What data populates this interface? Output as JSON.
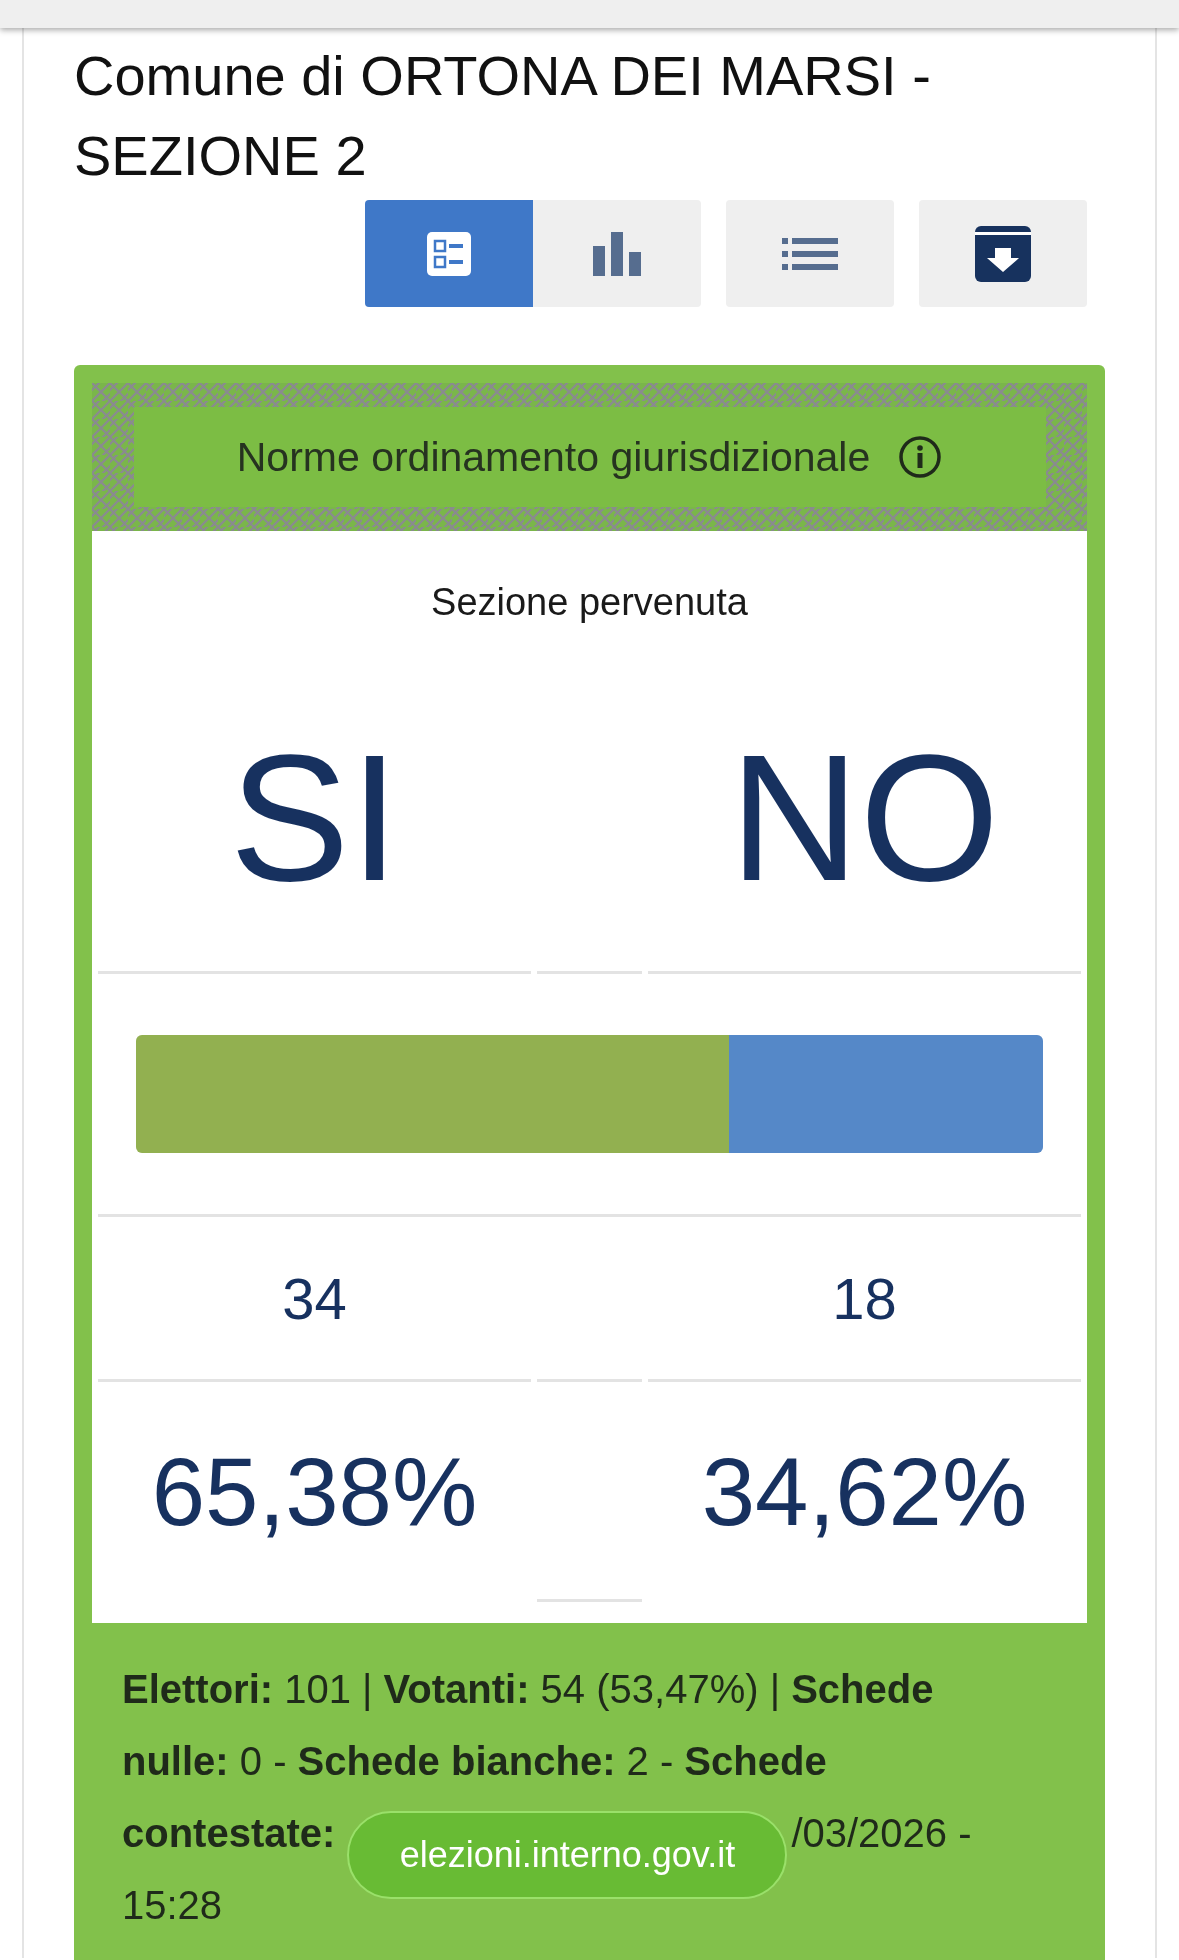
{
  "title": "Comune di ORTONA DEI MARSI - SEZIONE 2",
  "view_buttons": [
    {
      "kind": "summary",
      "selected": true
    },
    {
      "kind": "chart",
      "selected": false
    },
    {
      "kind": "list",
      "selected": false
    },
    {
      "kind": "archive",
      "selected": false
    }
  ],
  "card": {
    "heading": "Norme ordinamento giurisdizionale",
    "status": "Sezione pervenuta",
    "results": [
      {
        "label": "SI",
        "votes": "34",
        "percent": "65,38%",
        "level": 0.6538,
        "color": "#92b050"
      },
      {
        "label": "NO",
        "votes": "18",
        "percent": "34,62%",
        "level": 0.3462,
        "color": "#5588c8"
      }
    ],
    "stats": "**Elettori:** 101 | **Votanti:** 54 (53,47%) | **Schede nulle:** 0 - **Schede bianche:** 2 - **Schede**",
    "stats_label": "contestate:",
    "stats_tail": "/03/2026 -",
    "stats_time": "15:28"
  },
  "url_pill": "elezioni.interno.gov.it"
}
